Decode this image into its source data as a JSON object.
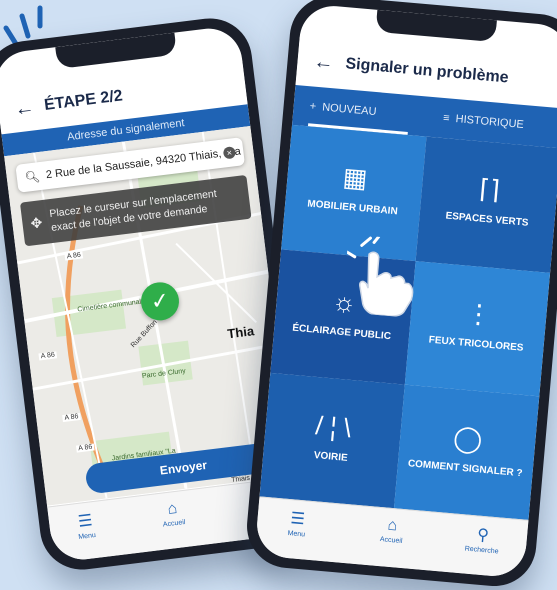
{
  "left_phone": {
    "title": "ÉTAPE 2/2",
    "banner": "Adresse du signalement",
    "search_value": "2 Rue de la Saussaie, 94320 Thiais, Fra",
    "tooltip": "Placez le curseur sur l'emplacement exact de l'objet de votre demande",
    "map_labels": {
      "cemetery": "Cimetière communal de Thiais",
      "street": "Rue Buffon",
      "park": "Parc de Cluny",
      "city": "Thia",
      "gardens": "Jardins familiaux \"La Résistance\"",
      "road_a86_1": "A 86",
      "road_a86_2": "A 86",
      "road_a86_3": "A 86",
      "road_a86_4": "A 86",
      "village": "Thiais Village"
    },
    "send_button": "Envoyer",
    "nav": {
      "menu": "Menu",
      "home": "Accueil"
    }
  },
  "right_phone": {
    "title": "Signaler un problème",
    "tabs": {
      "new": "NOUVEAU",
      "history": "HISTORIQUE"
    },
    "tiles": [
      {
        "label": "MOBILIER URBAIN",
        "icon": "bench-icon"
      },
      {
        "label": "ESPACES VERTS",
        "icon": "tree-icon"
      },
      {
        "label": "ÉCLAIRAGE PUBLIC",
        "icon": "lightbulb-icon"
      },
      {
        "label": "FEUX TRICOLORES",
        "icon": "traffic-light-icon"
      },
      {
        "label": "VOIRIE",
        "icon": "road-icon"
      },
      {
        "label": "COMMENT SIGNALER ?",
        "icon": "question-icon"
      }
    ],
    "nav": {
      "menu": "Menu",
      "home": "Accueil",
      "search": "Recherche"
    }
  },
  "colors": {
    "primary_blue": "#1f63b4",
    "tile_light": "#2a7fd0",
    "tile_dark": "#1d5fae",
    "success_green": "#2fae4a",
    "background": "#cfe0f3"
  }
}
